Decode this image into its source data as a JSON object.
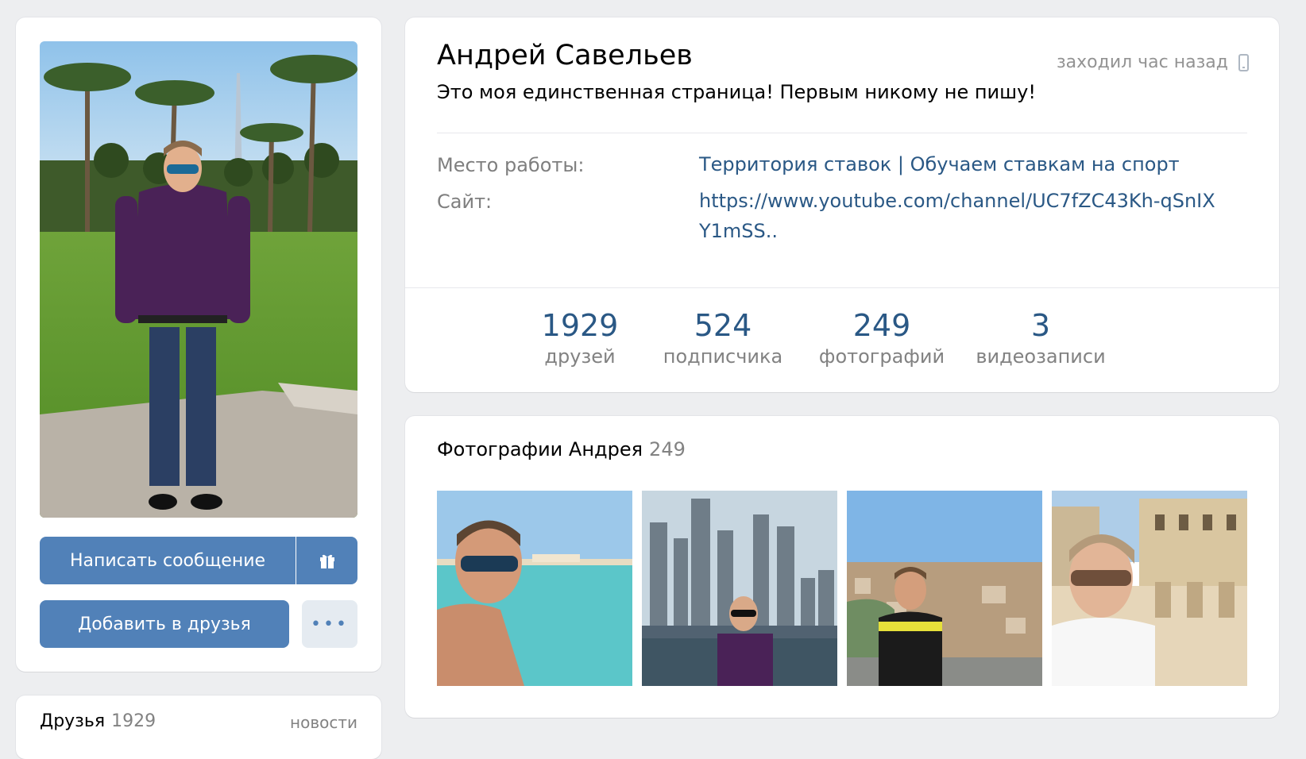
{
  "profile": {
    "name": "Андрей Савельев",
    "status": "Это моя единственная страница! Первым никому не пишу!",
    "last_seen": "заходил час назад",
    "work_label": "Место работы:",
    "work_value": "Территория ставок | Обучаем ставкам на спорт",
    "site_label": "Сайт:",
    "site_value": "https://www.youtube.com/channel/UC7fZC43Kh-qSnIXY1mSS.."
  },
  "counters": [
    {
      "num": "1929",
      "label": "друзей"
    },
    {
      "num": "524",
      "label": "подписчика"
    },
    {
      "num": "249",
      "label": "фотографий"
    },
    {
      "num": "3",
      "label": "видеозаписи"
    }
  ],
  "actions": {
    "message": "Написать сообщение",
    "add_friend": "Добавить в друзья",
    "more": "•••"
  },
  "friends_block": {
    "title": "Друзья",
    "count": "1929",
    "news": "новости"
  },
  "photos": {
    "title": "Фотографии Андрея",
    "count": "249"
  },
  "icons": {
    "gift": "gift-icon",
    "phone": "mobile-phone-icon",
    "more": "more-dots-icon"
  },
  "colors": {
    "accent": "#5181b8",
    "link": "#2a5885",
    "muted": "#828282",
    "background": "#edeef0"
  }
}
